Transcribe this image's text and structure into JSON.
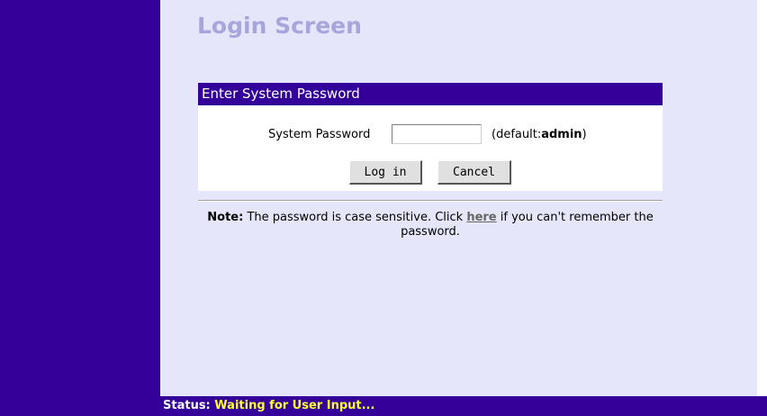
{
  "page": {
    "title": "Login Screen"
  },
  "panel": {
    "header": "Enter System Password",
    "password_label": "System Password",
    "password_value": "",
    "default_prefix": "(default:",
    "default_value": "admin",
    "default_suffix": ")",
    "login_label": "Log in",
    "cancel_label": "Cancel"
  },
  "note": {
    "label": "Note:",
    "text_before": " The password is case sensitive. Click ",
    "link": "here",
    "text_after": " if you can't remember the password."
  },
  "status": {
    "label": "Status:",
    "value": "Waiting for User Input..."
  },
  "colors": {
    "brand": "#330099",
    "content_bg": "#e6e6fa",
    "title": "#a6a6dc",
    "status_value": "#ffff33"
  }
}
